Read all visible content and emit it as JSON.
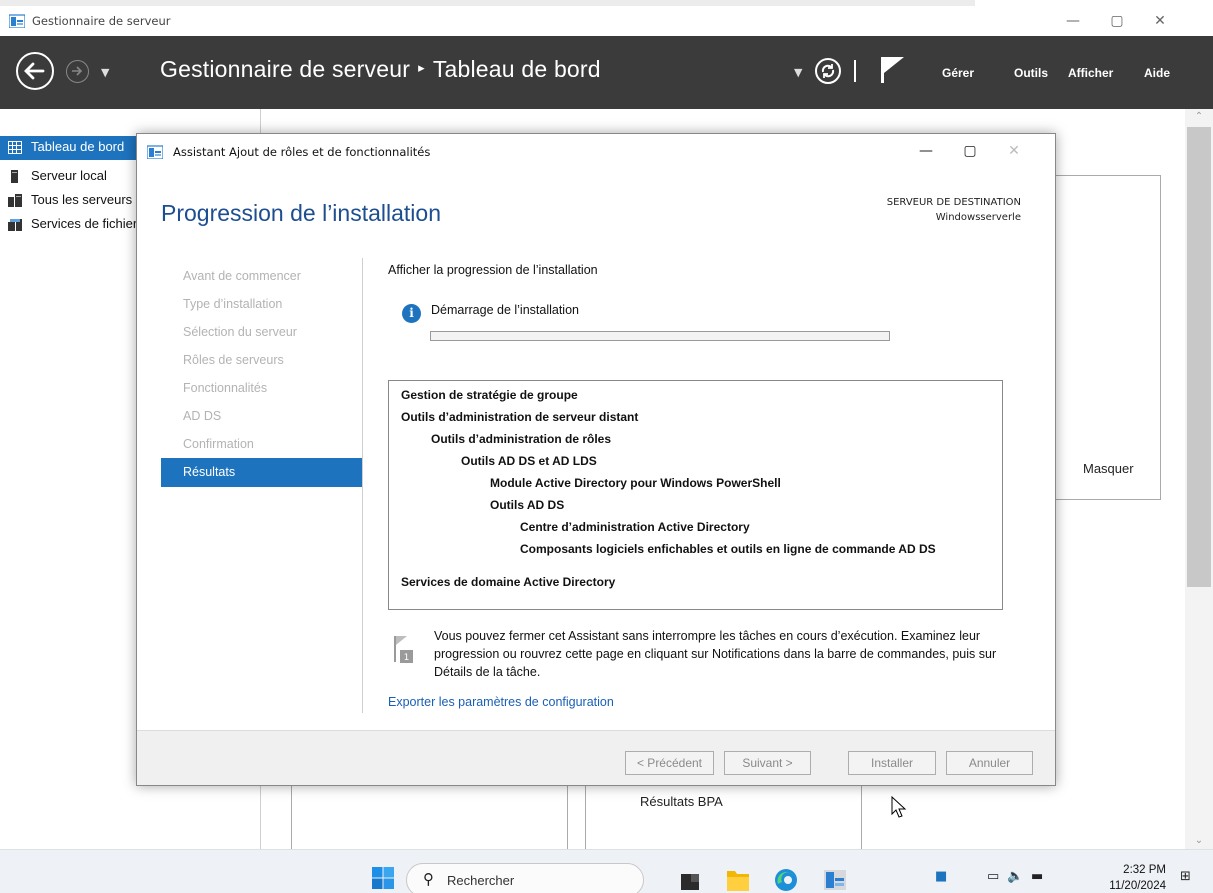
{
  "window": {
    "title": "Gestionnaire de serveur",
    "minimize": "—",
    "restore": "▢",
    "close": "✕"
  },
  "header": {
    "crumb_root": "Gestionnaire de serveur",
    "crumb_separator": "▸",
    "crumb_current": "Tableau de bord",
    "menu": [
      "Gérer",
      "Outils",
      "Afficher",
      "Aide"
    ]
  },
  "sidebar": {
    "items": [
      {
        "label": "Tableau de bord",
        "icon": "dashboard-icon",
        "active": true
      },
      {
        "label": "Serveur local",
        "icon": "server-icon",
        "active": false
      },
      {
        "label": "Tous les serveurs",
        "icon": "servers-icon",
        "active": false
      },
      {
        "label": "Services de fichiers et de stockage",
        "icon": "storage-icon",
        "active": false
      }
    ]
  },
  "background": {
    "hide_label": "Masquer",
    "bpa_label": "Résultats BPA"
  },
  "wizard": {
    "title": "Assistant Ajout de rôles et de fonctionnalités",
    "heading": "Progression de l’installation",
    "dest_label": "SERVEUR DE DESTINATION",
    "dest_value": "Windowsserverle",
    "steps": [
      "Avant de commencer",
      "Type d’installation",
      "Sélection du serveur",
      "Rôles de serveurs",
      "Fonctionnalités",
      "AD DS",
      "Confirmation"
    ],
    "active_step": "Résultats",
    "subheading": "Afficher la progression de l’installation",
    "status": "Démarrage de l’installation",
    "progress": 0,
    "features": [
      {
        "text": "Gestion de stratégie de groupe",
        "level": 0
      },
      {
        "text": "Outils d’administration de serveur distant",
        "level": 0
      },
      {
        "text": "Outils d’administration de rôles",
        "level": 1
      },
      {
        "text": "Outils AD DS et AD LDS",
        "level": 2
      },
      {
        "text": "Module Active Directory pour Windows PowerShell",
        "level": 3
      },
      {
        "text": "Outils AD DS",
        "level": 3
      },
      {
        "text": "Centre d’administration Active Directory",
        "level": 4
      },
      {
        "text": "Composants logiciels enfichables et outils en ligne de commande AD DS",
        "level": 4
      },
      {
        "text": "Services de domaine Active Directory",
        "level": 0
      }
    ],
    "note": "Vous pouvez fermer cet Assistant sans interrompre les tâches en cours d’exécution. Examinez leur progression ou rouvrez cette page en cliquant sur Notifications dans la barre de commandes, puis sur Détails de la tâche.",
    "export_link": "Exporter les paramètres de configuration",
    "buttons": {
      "previous": "< Précédent",
      "next": "Suivant >",
      "install": "Installer",
      "cancel": "Annuler"
    },
    "flag_badge": "1"
  },
  "taskbar": {
    "search_placeholder": "Rechercher",
    "time": "2:32 PM",
    "date": "11/20/2024"
  },
  "colors": {
    "accent": "#1e73be",
    "header_bg": "#3b3b3b",
    "heading": "#1d4e8f",
    "link": "#1a5fb4"
  }
}
